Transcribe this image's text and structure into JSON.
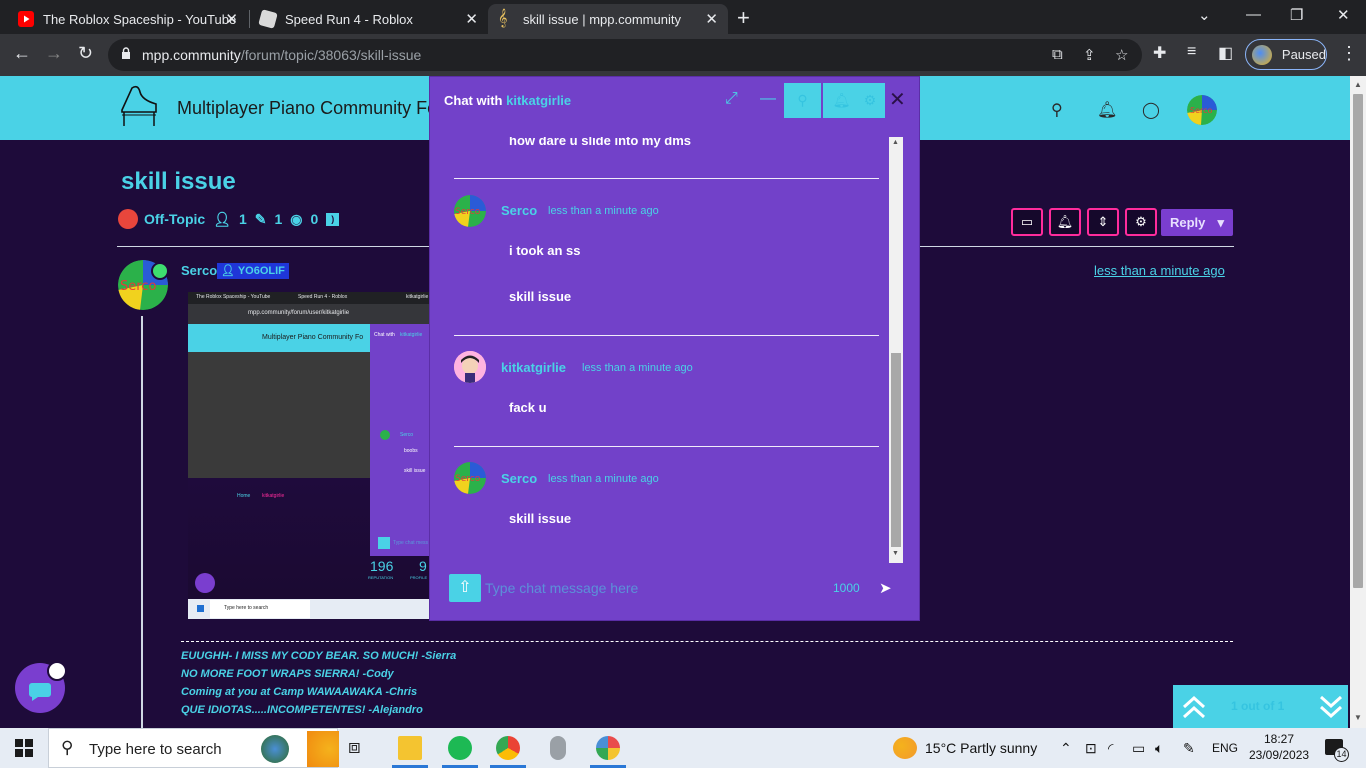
{
  "browser": {
    "tabs": [
      {
        "title": "The Roblox Spaceship - YouTube",
        "icon": "youtube-icon"
      },
      {
        "title": "Speed Run 4 - Roblox",
        "icon": "roblox-icon"
      },
      {
        "title": "skill issue | mpp.community",
        "icon": "treble-clef-icon",
        "active": true
      }
    ],
    "url_host": "mpp.community",
    "url_path": "/forum/topic/38063/skill-issue",
    "profile_status": "Paused"
  },
  "site": {
    "title": "Multiplayer Piano Community Fo",
    "accent": "#4ad2e6"
  },
  "topic": {
    "title": "skill issue",
    "category": "Off-Topic",
    "posters": "1",
    "posts": "1",
    "views": "0",
    "reply_label": "Reply"
  },
  "post": {
    "author": "Serco",
    "badge": "YO6OLIF",
    "time": "less than a minute ago",
    "signature": [
      "EUUGHH- I MISS MY CODY BEAR. SO MUCH! -Sierra",
      "NO MORE FOOT WRAPS SIERRA! -Cody",
      "Coming at you at Camp WAWAAWAKA -Chris",
      "QUE IDIOTAS.....INCOMPETENTES! -Alejandro"
    ]
  },
  "embedded": {
    "tab1": "The Roblox Spaceship - YouTube",
    "tab2": "Speed Run 4 - Roblox",
    "tab3": "kitkatgirlie",
    "url": "mpp.community/forum/user/kitkatgirlie",
    "site_title": "Multiplayer Piano Community Fo",
    "chat_with": "Chat with",
    "chat_name": "kitkatgirlie",
    "msg_author": "Serco",
    "msg1": "boobs",
    "msg2": "skill issue",
    "breadcrumb_home": "Home",
    "breadcrumb_user": "kitkatgirlie",
    "input_placeholder": "Type chat mess",
    "stat1_value": "196",
    "stat1_label": "REPUTATION",
    "stat2_value": "9",
    "stat2_label": "PROFILE",
    "search_placeholder": "Type here to search"
  },
  "pager": {
    "text": "1 out of 1"
  },
  "chat": {
    "title_prefix": "Chat with",
    "title_name": "kitkatgirlie",
    "partial_message": "how dare u slide into my dms",
    "messages": [
      {
        "author": "Serco",
        "time": "less than a minute ago",
        "lines": [
          "i took an ss",
          "skill issue"
        ]
      },
      {
        "author": "kitkatgirlie",
        "time": "less than a minute ago",
        "lines": [
          "fack u"
        ]
      },
      {
        "author": "Serco",
        "time": "less than a minute ago",
        "lines": [
          "skill issue"
        ]
      }
    ],
    "input_placeholder": "Type chat message here",
    "char_count": "1000"
  },
  "taskbar": {
    "search_placeholder": "Type here to search",
    "weather": "15°C  Partly sunny",
    "language": "ENG",
    "time": "18:27",
    "date": "23/09/2023",
    "notifications": "14"
  }
}
